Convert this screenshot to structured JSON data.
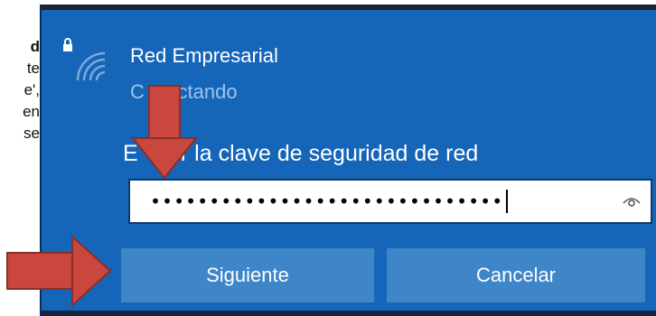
{
  "document_fragment": {
    "lines": [
      "d",
      "te",
      "e',",
      "en",
      "se"
    ]
  },
  "dialog": {
    "network_name": "Red Empresarial",
    "status": "Conectando",
    "status_visible": "C      ctando",
    "prompt": "Escribir la clave de seguridad de red",
    "prompt_visible": "E      ir la clave de seguridad de red",
    "password_masked": "••••••••••••••••••••••••••••••",
    "buttons": {
      "next_label": "Siguiente",
      "cancel_label": "Cancelar"
    }
  },
  "icons": {
    "wifi": "wifi-secured-icon",
    "lock": "lock-icon",
    "reveal": "reveal-password-eye-icon"
  },
  "annotations": {
    "arrow_color": "#c9473f",
    "arrow_count": 2
  },
  "colors": {
    "panel_bg": "#1565b8",
    "button_bg": "#3f86c9"
  }
}
